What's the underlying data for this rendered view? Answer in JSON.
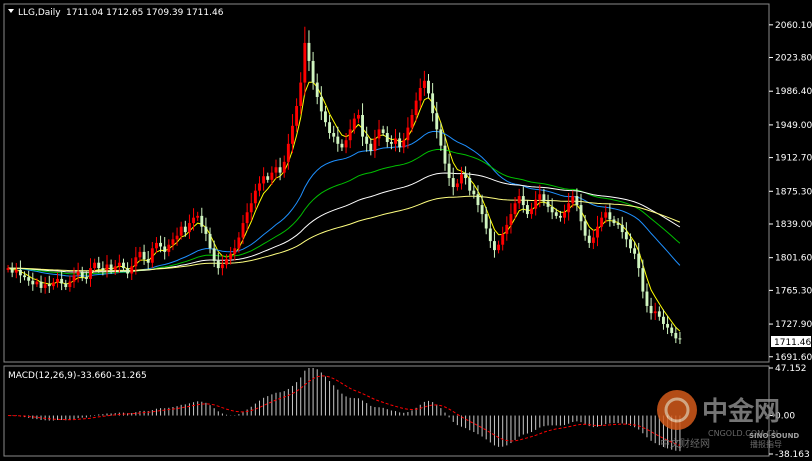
{
  "chart": {
    "symbol": "LLG,Daily",
    "ohlc": "1711.04 1712.65 1709.39 1711.46",
    "current_price": 1711.46
  },
  "chart_data": [
    {
      "type": "candlestick",
      "y_ticks": [
        2060.1,
        2023.8,
        1986.4,
        1949.0,
        1912.7,
        1875.3,
        1839.0,
        1801.6,
        1765.3,
        1727.9,
        1691.6
      ],
      "ylim": [
        1688,
        2081
      ],
      "up_color": "#ff0000",
      "down_color": "#d0f5c0",
      "closes": [
        1790,
        1785,
        1788,
        1782,
        1780,
        1776,
        1772,
        1775,
        1768,
        1772,
        1770,
        1774,
        1778,
        1773,
        1769,
        1775,
        1782,
        1786,
        1780,
        1778,
        1790,
        1796,
        1790,
        1788,
        1794,
        1788,
        1792,
        1796,
        1790,
        1784,
        1792,
        1802,
        1808,
        1800,
        1796,
        1812,
        1818,
        1814,
        1808,
        1816,
        1822,
        1826,
        1836,
        1830,
        1840,
        1846,
        1848,
        1836,
        1828,
        1812,
        1798,
        1790,
        1794,
        1800,
        1806,
        1812,
        1824,
        1840,
        1852,
        1862,
        1876,
        1884,
        1892,
        1888,
        1896,
        1902,
        1896,
        1908,
        1928,
        1948,
        1970,
        1996,
        2040,
        2020,
        1996,
        1980,
        1964,
        1952,
        1940,
        1936,
        1928,
        1924,
        1932,
        1944,
        1956,
        1960,
        1936,
        1928,
        1920,
        1934,
        1944,
        1940,
        1930,
        1928,
        1934,
        1924,
        1932,
        1946,
        1960,
        1976,
        1990,
        1998,
        1984,
        1962,
        1944,
        1926,
        1906,
        1890,
        1880,
        1884,
        1894,
        1890,
        1876,
        1872,
        1860,
        1850,
        1834,
        1820,
        1810,
        1816,
        1828,
        1838,
        1850,
        1862,
        1870,
        1860,
        1850,
        1856,
        1866,
        1872,
        1864,
        1858,
        1852,
        1848,
        1846,
        1852,
        1862,
        1870,
        1860,
        1842,
        1826,
        1818,
        1824,
        1836,
        1846,
        1852,
        1844,
        1840,
        1838,
        1830,
        1822,
        1812,
        1806,
        1790,
        1764,
        1748,
        1740,
        1742,
        1736,
        1728,
        1724,
        1718,
        1712,
        1711.46
      ],
      "indicators": [
        {
          "type": "ema",
          "period": 5,
          "color": "#ffff00"
        },
        {
          "type": "ema",
          "period": 34,
          "color": "#1e90ff"
        },
        {
          "type": "ema",
          "period": 55,
          "color": "#00c000"
        },
        {
          "type": "ema",
          "period": 89,
          "color": "#ffffff"
        },
        {
          "type": "ema",
          "period": 144,
          "color": "#ffff80"
        }
      ]
    },
    {
      "type": "histogram",
      "title": "MACD(12,26,9)",
      "macd_value": "-33.660",
      "signal_value": "-31.265",
      "y_ticks": [
        47.152,
        0.0,
        -38.163
      ],
      "histogram_color": "#c8c8c8",
      "signal_color": "#ff0000"
    }
  ],
  "watermark": {
    "brand_cn": "中金网",
    "url": "CNGOLD.COM.CN",
    "brand_en": "SINO SOUND",
    "sub_cn": "中文财经网",
    "sub2_cn": "播报指导"
  }
}
